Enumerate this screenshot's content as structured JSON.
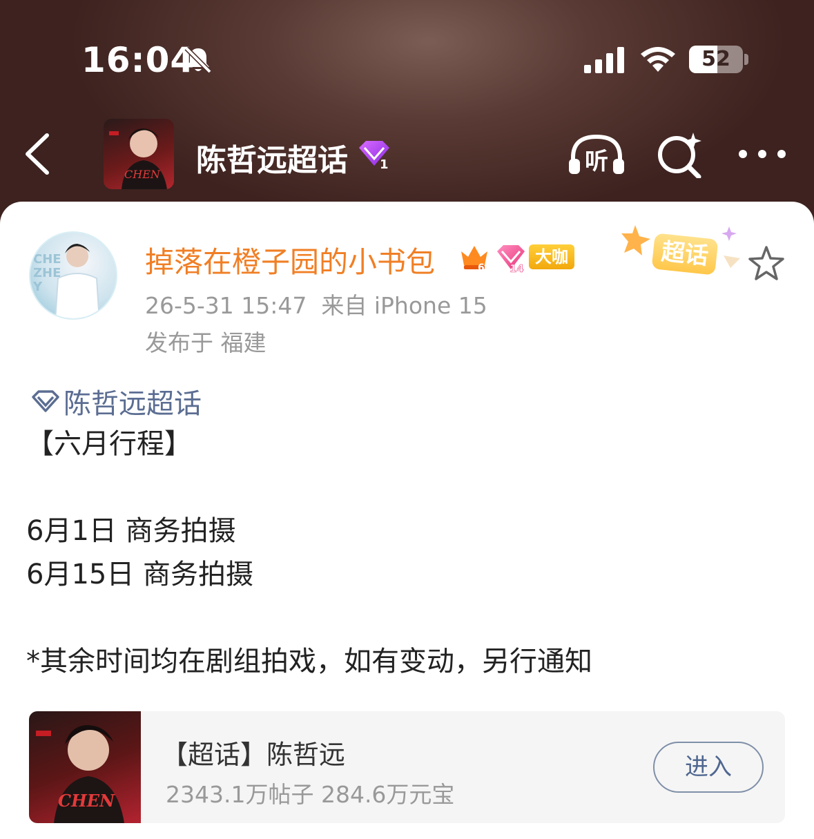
{
  "status_bar": {
    "time": "16:04",
    "battery_percent": "52",
    "battery_level": 0.52
  },
  "header": {
    "title": "陈哲远超话",
    "level_badge": "1",
    "listen_label": "听"
  },
  "post": {
    "author": {
      "name": "掉落在橙子园的小书包",
      "crown_level": "6",
      "gem_level": "14",
      "role_badge": "大咖"
    },
    "chaohua_badge": "超话",
    "timestamp": "26-5-31 15:47",
    "source": "来自 iPhone 15",
    "location": "发布于 福建",
    "topic_link": "陈哲远超话",
    "body": "【六月行程】\n\n6月1日 商务拍摄\n6月15日 商务拍摄\n\n*其余时间均在剧组拍戏，如有变动，另行通知"
  },
  "topic_card": {
    "name": "【超话】陈哲远",
    "stats": "2343.1万帖子 284.6万元宝",
    "enter_label": "进入"
  },
  "colors": {
    "username": "#f07f25",
    "topic_link": "#5b6d92",
    "meta": "#999999",
    "header_bg": "#5a3a34"
  }
}
